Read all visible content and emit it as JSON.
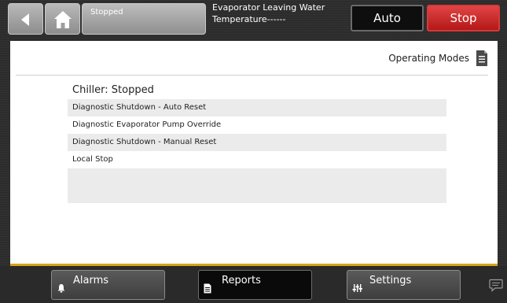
{
  "topbar": {
    "status_text": "Stopped",
    "evap_label_line1": "Evaporator Leaving Water",
    "evap_label_line2": "Temperature------",
    "auto_label": "Auto",
    "stop_label": "Stop"
  },
  "panel": {
    "title": "Operating Modes",
    "heading": "Chiller:  Stopped",
    "rows": [
      "Diagnostic Shutdown - Auto Reset",
      "Diagnostic Evaporator Pump Override",
      "Diagnostic Shutdown - Manual Reset",
      "Local Stop",
      "",
      ""
    ]
  },
  "bottombar": {
    "alarms_label": "Alarms",
    "reports_label": "Reports",
    "settings_label": "Settings",
    "selected_tab": "Reports"
  },
  "icons": [
    "back-arrow-icon",
    "home-icon",
    "document-icon",
    "bell-icon",
    "report-icon",
    "sliders-icon",
    "chat-icon"
  ],
  "colors": {
    "stop_red": "#c92424",
    "accent_gold": "#d6a51a",
    "panel_bg": "#ffffff",
    "row_shade": "#ebebeb"
  }
}
